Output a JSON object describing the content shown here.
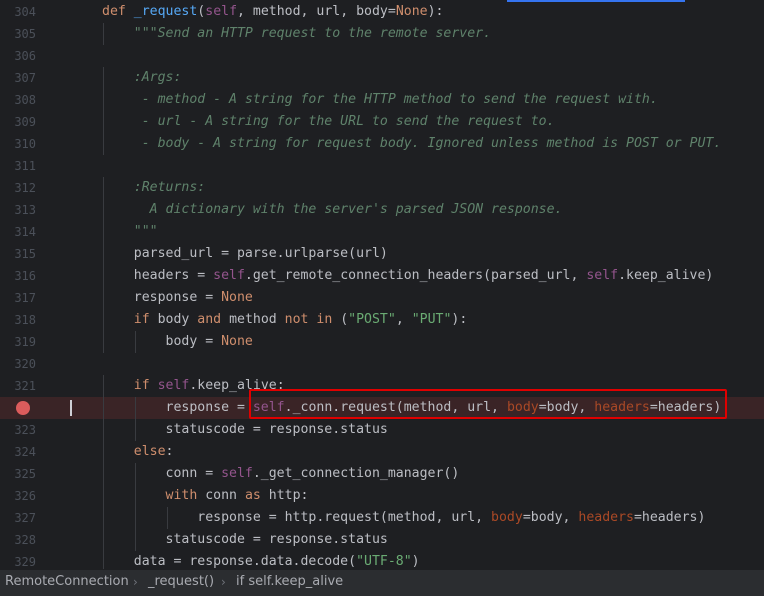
{
  "editor": {
    "lines": [
      {
        "num": "304",
        "tokens": [
          {
            "t": "def ",
            "c": "kw"
          },
          {
            "t": "_request",
            "c": "fn"
          },
          {
            "t": "(",
            "c": ""
          },
          {
            "t": "self",
            "c": "self"
          },
          {
            "t": ", method, url, body=",
            "c": ""
          },
          {
            "t": "None",
            "c": "kw"
          },
          {
            "t": "):",
            "c": ""
          }
        ]
      },
      {
        "num": "305",
        "tokens": [
          {
            "t": "    \"\"\"Send an HTTP request to the remote server.",
            "c": "doc"
          }
        ]
      },
      {
        "num": "306",
        "tokens": []
      },
      {
        "num": "307",
        "tokens": [
          {
            "t": "    :Args:",
            "c": "doc"
          }
        ]
      },
      {
        "num": "308",
        "tokens": [
          {
            "t": "     - method - A string for the HTTP method to send the request with.",
            "c": "doc"
          }
        ]
      },
      {
        "num": "309",
        "tokens": [
          {
            "t": "     - url - A string for the URL to send the request to.",
            "c": "doc"
          }
        ]
      },
      {
        "num": "310",
        "tokens": [
          {
            "t": "     - body - A string for request body. Ignored unless method is POST or PUT.",
            "c": "doc"
          }
        ]
      },
      {
        "num": "311",
        "tokens": []
      },
      {
        "num": "312",
        "tokens": [
          {
            "t": "    :Returns:",
            "c": "doc"
          }
        ]
      },
      {
        "num": "313",
        "tokens": [
          {
            "t": "      A dictionary with the server's parsed JSON response.",
            "c": "doc"
          }
        ]
      },
      {
        "num": "314",
        "tokens": [
          {
            "t": "    \"\"\"",
            "c": "doc"
          }
        ]
      },
      {
        "num": "315",
        "tokens": [
          {
            "t": "    parsed_url = parse.urlparse(url)",
            "c": ""
          }
        ]
      },
      {
        "num": "316",
        "tokens": [
          {
            "t": "    headers = ",
            "c": ""
          },
          {
            "t": "self",
            "c": "self"
          },
          {
            "t": ".get_remote_connection_headers(parsed_url, ",
            "c": ""
          },
          {
            "t": "self",
            "c": "self"
          },
          {
            "t": ".keep_alive)",
            "c": ""
          }
        ]
      },
      {
        "num": "317",
        "tokens": [
          {
            "t": "    response = ",
            "c": ""
          },
          {
            "t": "None",
            "c": "kw"
          }
        ]
      },
      {
        "num": "318",
        "tokens": [
          {
            "t": "    ",
            "c": ""
          },
          {
            "t": "if ",
            "c": "kw"
          },
          {
            "t": "body ",
            "c": ""
          },
          {
            "t": "and ",
            "c": "kw"
          },
          {
            "t": "method ",
            "c": ""
          },
          {
            "t": "not in ",
            "c": "kw"
          },
          {
            "t": "(",
            "c": ""
          },
          {
            "t": "\"POST\"",
            "c": "str"
          },
          {
            "t": ", ",
            "c": ""
          },
          {
            "t": "\"PUT\"",
            "c": "str"
          },
          {
            "t": "):",
            "c": ""
          }
        ]
      },
      {
        "num": "319",
        "tokens": [
          {
            "t": "        body = ",
            "c": ""
          },
          {
            "t": "None",
            "c": "kw"
          }
        ]
      },
      {
        "num": "320",
        "tokens": []
      },
      {
        "num": "321",
        "tokens": [
          {
            "t": "    ",
            "c": ""
          },
          {
            "t": "if ",
            "c": "kw"
          },
          {
            "t": "self",
            "c": "self"
          },
          {
            "t": ".keep_alive:",
            "c": ""
          }
        ]
      },
      {
        "num": "",
        "breakpoint": true,
        "tokens": [
          {
            "t": "        response = ",
            "c": ""
          },
          {
            "t": "self",
            "c": "self"
          },
          {
            "t": "._conn.request(method, url, ",
            "c": ""
          },
          {
            "t": "body",
            "c": "kwarg"
          },
          {
            "t": "=body, ",
            "c": ""
          },
          {
            "t": "headers",
            "c": "kwarg"
          },
          {
            "t": "=headers)",
            "c": ""
          }
        ]
      },
      {
        "num": "323",
        "tokens": [
          {
            "t": "        statuscode = response.status",
            "c": ""
          }
        ]
      },
      {
        "num": "324",
        "tokens": [
          {
            "t": "    ",
            "c": ""
          },
          {
            "t": "else",
            "c": "kw"
          },
          {
            "t": ":",
            "c": ""
          }
        ]
      },
      {
        "num": "325",
        "tokens": [
          {
            "t": "        conn = ",
            "c": ""
          },
          {
            "t": "self",
            "c": "self"
          },
          {
            "t": "._get_connection_manager()",
            "c": ""
          }
        ]
      },
      {
        "num": "326",
        "tokens": [
          {
            "t": "        ",
            "c": ""
          },
          {
            "t": "with ",
            "c": "kw"
          },
          {
            "t": "conn ",
            "c": ""
          },
          {
            "t": "as ",
            "c": "kw"
          },
          {
            "t": "http:",
            "c": ""
          }
        ]
      },
      {
        "num": "327",
        "tokens": [
          {
            "t": "            response = http.request(method, url, ",
            "c": ""
          },
          {
            "t": "body",
            "c": "kwarg"
          },
          {
            "t": "=body, ",
            "c": ""
          },
          {
            "t": "headers",
            "c": "kwarg"
          },
          {
            "t": "=headers)",
            "c": ""
          }
        ]
      },
      {
        "num": "328",
        "tokens": [
          {
            "t": "        statuscode = response.status",
            "c": ""
          }
        ]
      },
      {
        "num": "329",
        "tokens": [
          {
            "t": "    data = response.data.decode(",
            "c": ""
          },
          {
            "t": "\"UTF-8\"",
            "c": "str"
          },
          {
            "t": ")",
            "c": ""
          }
        ]
      }
    ]
  },
  "breadcrumb": {
    "class_name": "RemoteConnection",
    "method_name": "_request()",
    "block_name": "if self.keep_alive"
  },
  "colors": {
    "background": "#1e1f22",
    "breakpoint": "#db5c5c",
    "highlight_box": "#e00000"
  }
}
